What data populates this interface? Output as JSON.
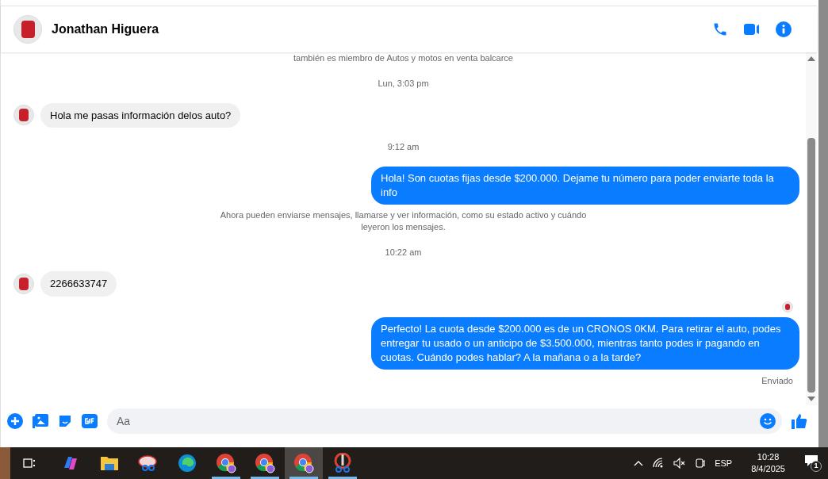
{
  "header": {
    "name": "Jonathan Higuera"
  },
  "messages": [
    {
      "kind": "notice",
      "text": "también es miembro de Autos y motos en venta balcarce"
    },
    {
      "kind": "time",
      "text": "Lun, 3:03 pm"
    },
    {
      "kind": "incoming",
      "text": "Hola me pasas información delos auto?"
    },
    {
      "kind": "time",
      "text": "9:12 am"
    },
    {
      "kind": "outgoing",
      "text": "Hola! Son cuotas fijas desde $200.000. Dejame tu número para poder enviarte toda la info"
    },
    {
      "kind": "notice",
      "text": "Ahora pueden enviarse mensajes, llamarse y ver información, como su estado activo y cuándo leyeron los mensajes."
    },
    {
      "kind": "time",
      "text": "10:22 am"
    },
    {
      "kind": "incoming",
      "text": "2266633747"
    },
    {
      "kind": "seen"
    },
    {
      "kind": "outgoing",
      "text": "Perfecto! La cuota desde $200.000 es de un CRONOS 0KM. Para retirar el auto, podes entregar tu usado o un anticipo de $3.500.000, mientras tanto podes ir pagando en cuotas. Cuándo podes hablar? A la mañana o a la tarde?"
    },
    {
      "kind": "status",
      "text": "Enviado"
    }
  ],
  "composer": {
    "placeholder": "Aa"
  },
  "taskbar": {
    "apps": [
      {
        "kind": "copilot",
        "running": false,
        "selected": false
      },
      {
        "kind": "folder",
        "running": false,
        "selected": false
      },
      {
        "kind": "snip",
        "running": false,
        "selected": false
      },
      {
        "kind": "edge",
        "running": false,
        "selected": false
      },
      {
        "kind": "chrome",
        "running": true,
        "selected": false
      },
      {
        "kind": "chrome",
        "running": true,
        "selected": false
      },
      {
        "kind": "chrome",
        "running": false,
        "selected": true
      },
      {
        "kind": "scissors",
        "running": true,
        "selected": false
      }
    ],
    "language": "ESP",
    "time": "10:28",
    "date": "8/4/2025",
    "notifications": "1"
  }
}
